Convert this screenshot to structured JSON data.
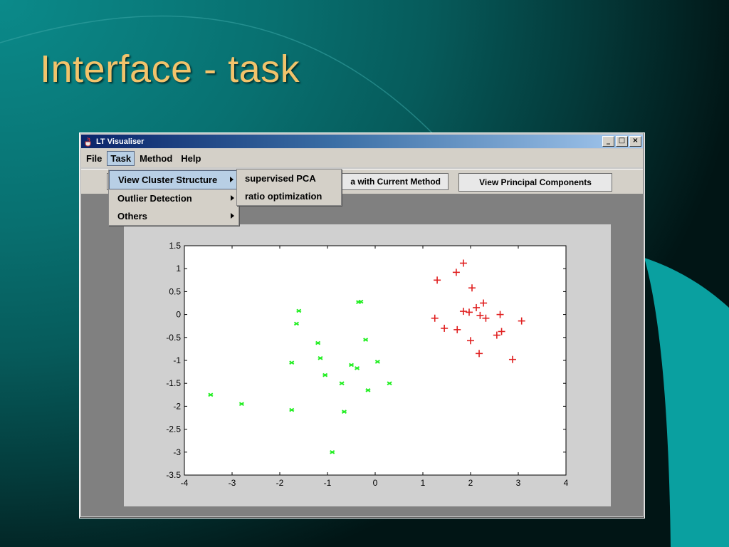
{
  "slide": {
    "title": "Interface - task"
  },
  "window": {
    "title": "LT Visualiser",
    "controls": {
      "minimize": "_",
      "maximize": "□",
      "close": "×"
    }
  },
  "menubar": {
    "file": "File",
    "task": "Task",
    "method": "Method",
    "help": "Help"
  },
  "toolbar": {
    "partial_button": "a with Current Method",
    "view_pc_button": "View Principal Components"
  },
  "task_menu": {
    "items": [
      {
        "label": "View Cluster Structure"
      },
      {
        "label": "Outlier Detection"
      },
      {
        "label": "Others"
      }
    ]
  },
  "submenu": {
    "items": [
      {
        "label": "supervised PCA"
      },
      {
        "label": "ratio optimization"
      }
    ]
  },
  "colors": {
    "green": "#22ee22",
    "red": "#e02020",
    "accent": "#f2c36b"
  },
  "chart_data": {
    "type": "scatter",
    "xlim": [
      -4,
      4
    ],
    "ylim": [
      -3.5,
      1.5
    ],
    "xticks": [
      "-4",
      "-3",
      "-2",
      "-1",
      "0",
      "1",
      "2",
      "3",
      "4"
    ],
    "yticks": [
      "1.5",
      "1",
      "0.5",
      "0",
      "-0.5",
      "-1",
      "-1.5",
      "-2",
      "-2.5",
      "-3",
      "-3.5"
    ],
    "series": [
      {
        "marker": "x",
        "color": "green",
        "points": [
          [
            -3.45,
            -1.75
          ],
          [
            -2.8,
            -1.95
          ],
          [
            -1.75,
            -1.05
          ],
          [
            -1.75,
            -2.08
          ],
          [
            -1.65,
            -0.2
          ],
          [
            -1.6,
            0.08
          ],
          [
            -1.2,
            -0.62
          ],
          [
            -1.15,
            -0.95
          ],
          [
            -1.05,
            -1.32
          ],
          [
            -0.9,
            -3.0
          ],
          [
            -0.7,
            -1.5
          ],
          [
            -0.65,
            -2.12
          ],
          [
            -0.5,
            -1.1
          ],
          [
            -0.38,
            -1.17
          ],
          [
            -0.35,
            0.27
          ],
          [
            -0.3,
            0.28
          ],
          [
            -0.2,
            -0.55
          ],
          [
            -0.15,
            -1.65
          ],
          [
            0.05,
            -1.03
          ],
          [
            0.3,
            -1.5
          ]
        ]
      },
      {
        "marker": "+",
        "color": "red",
        "points": [
          [
            1.25,
            -0.08
          ],
          [
            1.3,
            0.75
          ],
          [
            1.45,
            -0.3
          ],
          [
            1.7,
            0.92
          ],
          [
            1.72,
            -0.33
          ],
          [
            1.85,
            1.12
          ],
          [
            1.85,
            0.07
          ],
          [
            1.97,
            0.05
          ],
          [
            2.0,
            -0.57
          ],
          [
            2.03,
            0.58
          ],
          [
            2.12,
            0.15
          ],
          [
            2.18,
            -0.85
          ],
          [
            2.2,
            -0.02
          ],
          [
            2.27,
            0.25
          ],
          [
            2.32,
            -0.08
          ],
          [
            2.55,
            -0.45
          ],
          [
            2.62,
            0.0
          ],
          [
            2.65,
            -0.37
          ],
          [
            2.88,
            -0.98
          ],
          [
            3.07,
            -0.14
          ]
        ]
      }
    ]
  }
}
